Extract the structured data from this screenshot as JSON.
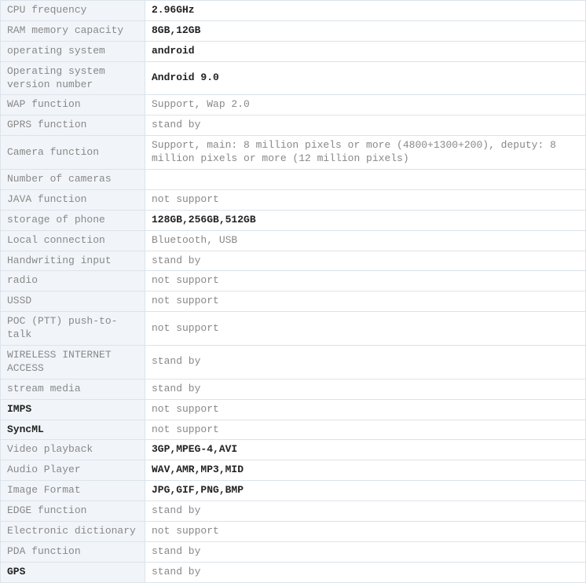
{
  "specs": [
    {
      "label": "CPU frequency",
      "value": "2.96GHz",
      "labelBold": false,
      "valueBold": true
    },
    {
      "label": "RAM memory capacity",
      "value": "8GB,12GB",
      "labelBold": false,
      "valueBold": true
    },
    {
      "label": "operating system",
      "value": "android",
      "labelBold": false,
      "valueBold": true
    },
    {
      "label": "Operating system version number",
      "value": "Android 9.0",
      "labelBold": false,
      "valueBold": true
    },
    {
      "label": "WAP function",
      "value": "Support, Wap 2.0",
      "labelBold": false,
      "valueBold": false
    },
    {
      "label": "GPRS function",
      "value": "stand by",
      "labelBold": false,
      "valueBold": false
    },
    {
      "label": "Camera function",
      "value": "Support, main: 8 million pixels or more (4800+1300+200), deputy: 8 million pixels or more (12 million pixels)",
      "labelBold": false,
      "valueBold": false
    },
    {
      "label": "Number of cameras",
      "value": "",
      "labelBold": false,
      "valueBold": false
    },
    {
      "label": "JAVA function",
      "value": "not support",
      "labelBold": false,
      "valueBold": false
    },
    {
      "label": "storage of phone",
      "value": "128GB,256GB,512GB",
      "labelBold": false,
      "valueBold": true
    },
    {
      "label": "Local connection",
      "value": "Bluetooth, USB",
      "labelBold": false,
      "valueBold": false
    },
    {
      "label": "Handwriting input",
      "value": "stand by",
      "labelBold": false,
      "valueBold": false
    },
    {
      "label": "radio",
      "value": "not support",
      "labelBold": false,
      "valueBold": false
    },
    {
      "label": "USSD",
      "value": "not support",
      "labelBold": false,
      "valueBold": false
    },
    {
      "label": "POC (PTT) push-to-talk",
      "value": "not support",
      "labelBold": false,
      "valueBold": false
    },
    {
      "label": "WIRELESS INTERNET ACCESS",
      "value": "stand by",
      "labelBold": false,
      "valueBold": false
    },
    {
      "label": "stream media",
      "value": "stand by",
      "labelBold": false,
      "valueBold": false
    },
    {
      "label": "IMPS",
      "value": "not support",
      "labelBold": true,
      "valueBold": false
    },
    {
      "label": "SyncML",
      "value": "not support",
      "labelBold": true,
      "valueBold": false
    },
    {
      "label": "Video playback",
      "value": "3GP,MPEG-4,AVI",
      "labelBold": false,
      "valueBold": true
    },
    {
      "label": "Audio Player",
      "value": "WAV,AMR,MP3,MID",
      "labelBold": false,
      "valueBold": true
    },
    {
      "label": "Image Format",
      "value": "JPG,GIF,PNG,BMP",
      "labelBold": false,
      "valueBold": true
    },
    {
      "label": "EDGE function",
      "value": "stand by",
      "labelBold": false,
      "valueBold": false
    },
    {
      "label": "Electronic dictionary",
      "value": "not support",
      "labelBold": false,
      "valueBold": false
    },
    {
      "label": "PDA function",
      "value": "stand by",
      "labelBold": false,
      "valueBold": false
    },
    {
      "label": "GPS",
      "value": "stand by",
      "labelBold": true,
      "valueBold": false
    }
  ]
}
